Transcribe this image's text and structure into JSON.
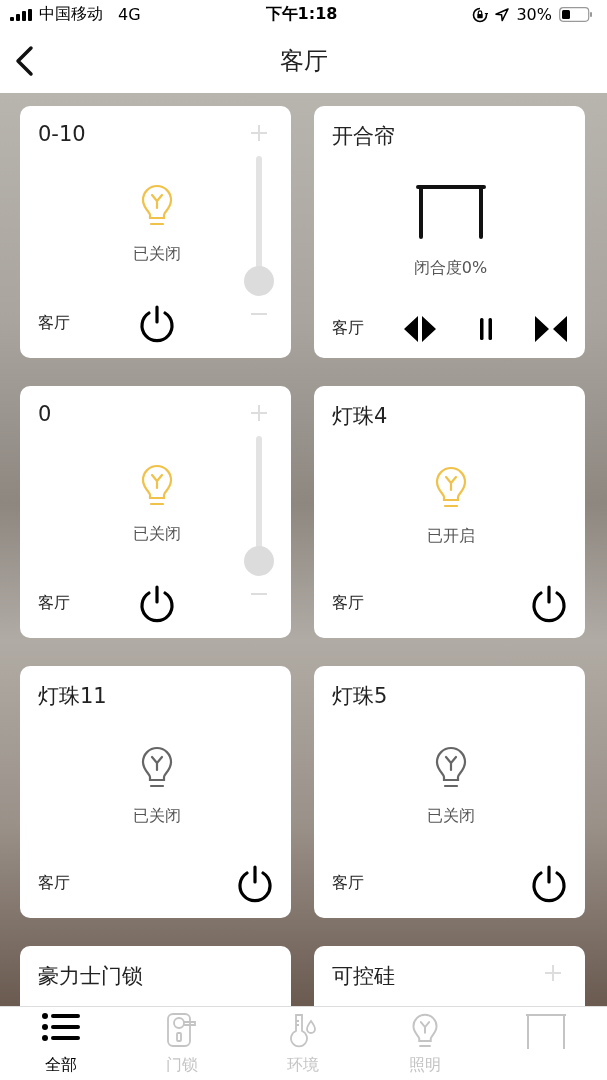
{
  "status_bar": {
    "carrier": "中国移动",
    "network": "4G",
    "time": "下午1:18",
    "battery": "30%"
  },
  "nav": {
    "title": "客厅"
  },
  "cards": [
    {
      "kind": "dimmer",
      "title": "0-10",
      "color": "#f0c24a",
      "status": "已关闭",
      "room": "客厅",
      "level": 0
    },
    {
      "kind": "curtain",
      "title": "开合帘",
      "status": "闭合度0%",
      "room": "客厅"
    },
    {
      "kind": "dimmer",
      "title": "0",
      "color": "#f0c24a",
      "status": "已关闭",
      "room": "客厅",
      "level": 0
    },
    {
      "kind": "light",
      "title": "灯珠4",
      "color": "#f0c24a",
      "status": "已开启",
      "room": "客厅"
    },
    {
      "kind": "light",
      "title": "灯珠11",
      "color": "#666666",
      "status": "已关闭",
      "room": "客厅"
    },
    {
      "kind": "light",
      "title": "灯珠5",
      "color": "#666666",
      "status": "已关闭",
      "room": "客厅"
    },
    {
      "kind": "lock",
      "title": "豪力士门锁"
    },
    {
      "kind": "dimmer",
      "title": "可控硅"
    }
  ],
  "tabs": [
    {
      "kind": "all",
      "label": "全部",
      "selected": true
    },
    {
      "kind": "lock",
      "label": "门锁",
      "selected": false
    },
    {
      "kind": "environment",
      "label": "环境",
      "selected": false
    },
    {
      "kind": "lighting",
      "label": "照明",
      "selected": false
    },
    {
      "kind": "curtain",
      "selected": false
    }
  ]
}
